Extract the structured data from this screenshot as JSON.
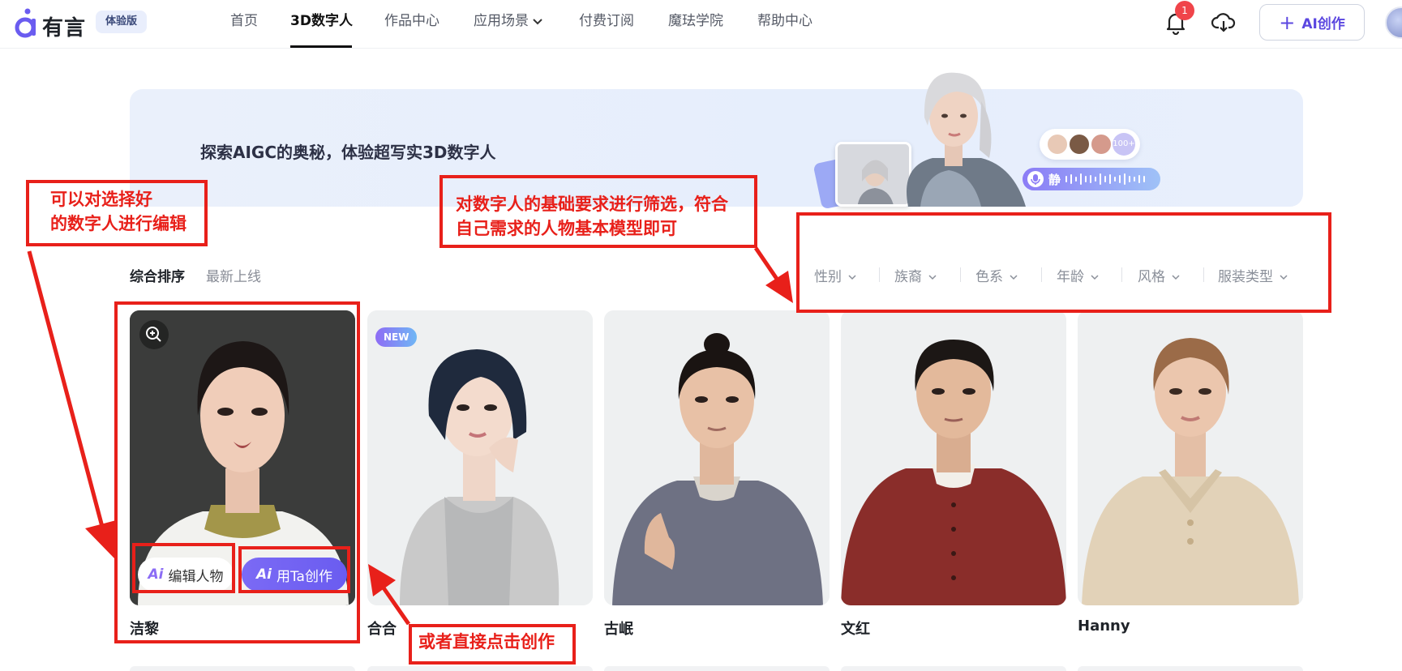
{
  "header": {
    "logo_text": "有言",
    "trial_badge": "体验版",
    "nav": [
      {
        "label": "首页"
      },
      {
        "label": "3D数字人"
      },
      {
        "label": "作品中心"
      },
      {
        "label": "应用场景"
      },
      {
        "label": "付费订阅"
      },
      {
        "label": "魔珐学院"
      },
      {
        "label": "帮助中心"
      }
    ],
    "notification_count": "1",
    "ai_create_label": "AI创作"
  },
  "banner": {
    "text": "探索AIGC的奥秘，体验超写实3D数字人",
    "avatars_count": "100+",
    "voice_word": "静"
  },
  "sort": {
    "items": [
      "综合排序",
      "最新上线"
    ]
  },
  "filters": [
    "性别",
    "族裔",
    "色系",
    "年龄",
    "风格",
    "服装类型"
  ],
  "cards": [
    {
      "name": "洁黎",
      "edit_label": "编辑人物",
      "use_label": "用Ta创作",
      "ai_mark": "Ai"
    },
    {
      "name": "合合",
      "badge": "NEW"
    },
    {
      "name": "古岷"
    },
    {
      "name": "文红"
    },
    {
      "name": "Hanny"
    }
  ],
  "annotations": {
    "edit_note_line1": "可以对选择好",
    "edit_note_line2": "的数字人进行编辑",
    "filter_note_line1": "对数字人的基础要求进行筛选，符合",
    "filter_note_line2": "自己需求的人物基本模型即可",
    "create_note": "或者直接点击创作"
  },
  "colors": {
    "accent": "#6a5cf0",
    "annotation_red": "#e8201a",
    "badge_red": "#f0444a"
  }
}
